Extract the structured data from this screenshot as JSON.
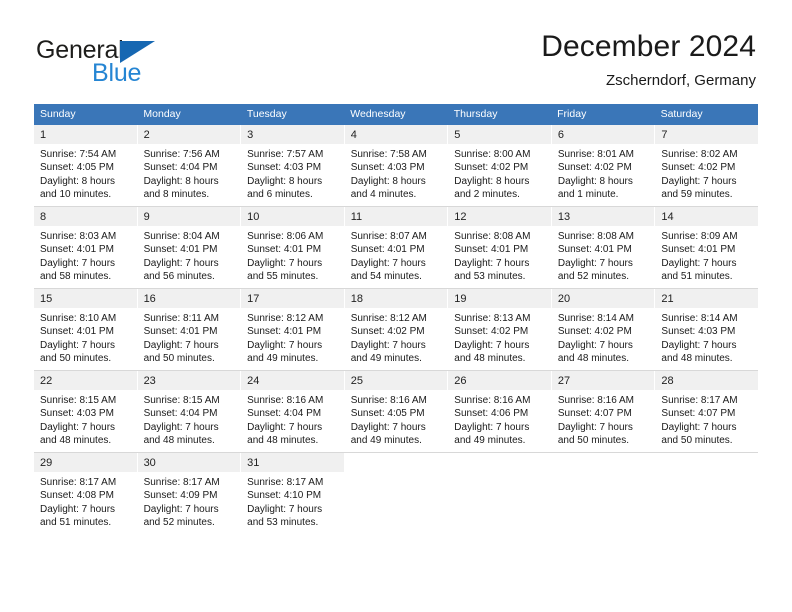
{
  "brand": {
    "word1": "General",
    "word2": "Blue",
    "accent_color": "#2585d3",
    "triangle_color": "#1667b2"
  },
  "header": {
    "title": "December 2024",
    "subtitle": "Zscherndorf, Germany"
  },
  "calendar": {
    "header_bg": "#3a76b8",
    "daynum_bg": "#f0f0f0",
    "weekdays": [
      "Sunday",
      "Monday",
      "Tuesday",
      "Wednesday",
      "Thursday",
      "Friday",
      "Saturday"
    ],
    "weeks": [
      [
        {
          "day": "1",
          "sunrise": "Sunrise: 7:54 AM",
          "sunset": "Sunset: 4:05 PM",
          "daylight1": "Daylight: 8 hours",
          "daylight2": "and 10 minutes."
        },
        {
          "day": "2",
          "sunrise": "Sunrise: 7:56 AM",
          "sunset": "Sunset: 4:04 PM",
          "daylight1": "Daylight: 8 hours",
          "daylight2": "and 8 minutes."
        },
        {
          "day": "3",
          "sunrise": "Sunrise: 7:57 AM",
          "sunset": "Sunset: 4:03 PM",
          "daylight1": "Daylight: 8 hours",
          "daylight2": "and 6 minutes."
        },
        {
          "day": "4",
          "sunrise": "Sunrise: 7:58 AM",
          "sunset": "Sunset: 4:03 PM",
          "daylight1": "Daylight: 8 hours",
          "daylight2": "and 4 minutes."
        },
        {
          "day": "5",
          "sunrise": "Sunrise: 8:00 AM",
          "sunset": "Sunset: 4:02 PM",
          "daylight1": "Daylight: 8 hours",
          "daylight2": "and 2 minutes."
        },
        {
          "day": "6",
          "sunrise": "Sunrise: 8:01 AM",
          "sunset": "Sunset: 4:02 PM",
          "daylight1": "Daylight: 8 hours",
          "daylight2": "and 1 minute."
        },
        {
          "day": "7",
          "sunrise": "Sunrise: 8:02 AM",
          "sunset": "Sunset: 4:02 PM",
          "daylight1": "Daylight: 7 hours",
          "daylight2": "and 59 minutes."
        }
      ],
      [
        {
          "day": "8",
          "sunrise": "Sunrise: 8:03 AM",
          "sunset": "Sunset: 4:01 PM",
          "daylight1": "Daylight: 7 hours",
          "daylight2": "and 58 minutes."
        },
        {
          "day": "9",
          "sunrise": "Sunrise: 8:04 AM",
          "sunset": "Sunset: 4:01 PM",
          "daylight1": "Daylight: 7 hours",
          "daylight2": "and 56 minutes."
        },
        {
          "day": "10",
          "sunrise": "Sunrise: 8:06 AM",
          "sunset": "Sunset: 4:01 PM",
          "daylight1": "Daylight: 7 hours",
          "daylight2": "and 55 minutes."
        },
        {
          "day": "11",
          "sunrise": "Sunrise: 8:07 AM",
          "sunset": "Sunset: 4:01 PM",
          "daylight1": "Daylight: 7 hours",
          "daylight2": "and 54 minutes."
        },
        {
          "day": "12",
          "sunrise": "Sunrise: 8:08 AM",
          "sunset": "Sunset: 4:01 PM",
          "daylight1": "Daylight: 7 hours",
          "daylight2": "and 53 minutes."
        },
        {
          "day": "13",
          "sunrise": "Sunrise: 8:08 AM",
          "sunset": "Sunset: 4:01 PM",
          "daylight1": "Daylight: 7 hours",
          "daylight2": "and 52 minutes."
        },
        {
          "day": "14",
          "sunrise": "Sunrise: 8:09 AM",
          "sunset": "Sunset: 4:01 PM",
          "daylight1": "Daylight: 7 hours",
          "daylight2": "and 51 minutes."
        }
      ],
      [
        {
          "day": "15",
          "sunrise": "Sunrise: 8:10 AM",
          "sunset": "Sunset: 4:01 PM",
          "daylight1": "Daylight: 7 hours",
          "daylight2": "and 50 minutes."
        },
        {
          "day": "16",
          "sunrise": "Sunrise: 8:11 AM",
          "sunset": "Sunset: 4:01 PM",
          "daylight1": "Daylight: 7 hours",
          "daylight2": "and 50 minutes."
        },
        {
          "day": "17",
          "sunrise": "Sunrise: 8:12 AM",
          "sunset": "Sunset: 4:01 PM",
          "daylight1": "Daylight: 7 hours",
          "daylight2": "and 49 minutes."
        },
        {
          "day": "18",
          "sunrise": "Sunrise: 8:12 AM",
          "sunset": "Sunset: 4:02 PM",
          "daylight1": "Daylight: 7 hours",
          "daylight2": "and 49 minutes."
        },
        {
          "day": "19",
          "sunrise": "Sunrise: 8:13 AM",
          "sunset": "Sunset: 4:02 PM",
          "daylight1": "Daylight: 7 hours",
          "daylight2": "and 48 minutes."
        },
        {
          "day": "20",
          "sunrise": "Sunrise: 8:14 AM",
          "sunset": "Sunset: 4:02 PM",
          "daylight1": "Daylight: 7 hours",
          "daylight2": "and 48 minutes."
        },
        {
          "day": "21",
          "sunrise": "Sunrise: 8:14 AM",
          "sunset": "Sunset: 4:03 PM",
          "daylight1": "Daylight: 7 hours",
          "daylight2": "and 48 minutes."
        }
      ],
      [
        {
          "day": "22",
          "sunrise": "Sunrise: 8:15 AM",
          "sunset": "Sunset: 4:03 PM",
          "daylight1": "Daylight: 7 hours",
          "daylight2": "and 48 minutes."
        },
        {
          "day": "23",
          "sunrise": "Sunrise: 8:15 AM",
          "sunset": "Sunset: 4:04 PM",
          "daylight1": "Daylight: 7 hours",
          "daylight2": "and 48 minutes."
        },
        {
          "day": "24",
          "sunrise": "Sunrise: 8:16 AM",
          "sunset": "Sunset: 4:04 PM",
          "daylight1": "Daylight: 7 hours",
          "daylight2": "and 48 minutes."
        },
        {
          "day": "25",
          "sunrise": "Sunrise: 8:16 AM",
          "sunset": "Sunset: 4:05 PM",
          "daylight1": "Daylight: 7 hours",
          "daylight2": "and 49 minutes."
        },
        {
          "day": "26",
          "sunrise": "Sunrise: 8:16 AM",
          "sunset": "Sunset: 4:06 PM",
          "daylight1": "Daylight: 7 hours",
          "daylight2": "and 49 minutes."
        },
        {
          "day": "27",
          "sunrise": "Sunrise: 8:16 AM",
          "sunset": "Sunset: 4:07 PM",
          "daylight1": "Daylight: 7 hours",
          "daylight2": "and 50 minutes."
        },
        {
          "day": "28",
          "sunrise": "Sunrise: 8:17 AM",
          "sunset": "Sunset: 4:07 PM",
          "daylight1": "Daylight: 7 hours",
          "daylight2": "and 50 minutes."
        }
      ],
      [
        {
          "day": "29",
          "sunrise": "Sunrise: 8:17 AM",
          "sunset": "Sunset: 4:08 PM",
          "daylight1": "Daylight: 7 hours",
          "daylight2": "and 51 minutes."
        },
        {
          "day": "30",
          "sunrise": "Sunrise: 8:17 AM",
          "sunset": "Sunset: 4:09 PM",
          "daylight1": "Daylight: 7 hours",
          "daylight2": "and 52 minutes."
        },
        {
          "day": "31",
          "sunrise": "Sunrise: 8:17 AM",
          "sunset": "Sunset: 4:10 PM",
          "daylight1": "Daylight: 7 hours",
          "daylight2": "and 53 minutes."
        },
        {
          "day": "",
          "sunrise": "",
          "sunset": "",
          "daylight1": "",
          "daylight2": ""
        },
        {
          "day": "",
          "sunrise": "",
          "sunset": "",
          "daylight1": "",
          "daylight2": ""
        },
        {
          "day": "",
          "sunrise": "",
          "sunset": "",
          "daylight1": "",
          "daylight2": ""
        },
        {
          "day": "",
          "sunrise": "",
          "sunset": "",
          "daylight1": "",
          "daylight2": ""
        }
      ]
    ]
  }
}
